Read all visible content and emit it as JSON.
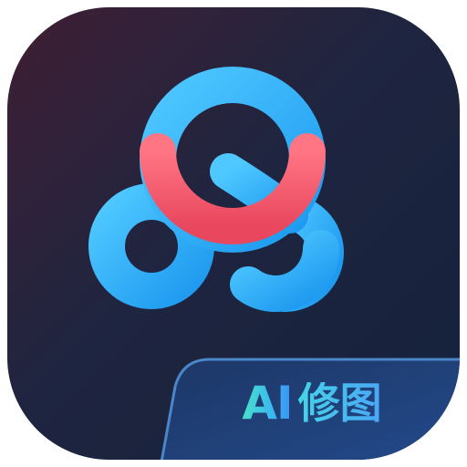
{
  "app_icon": {
    "logo": "cloud-rings-logo",
    "badge": {
      "ai_label": "AI",
      "text": "修图"
    },
    "colors": {
      "background_dark": "#1c2238",
      "background_warm": "#3c1e34",
      "ring_blue": "#37b8ff",
      "ring_coral": "#f3606e",
      "badge_fill": "#1e3f76",
      "badge_border": "#4b86c8"
    }
  }
}
